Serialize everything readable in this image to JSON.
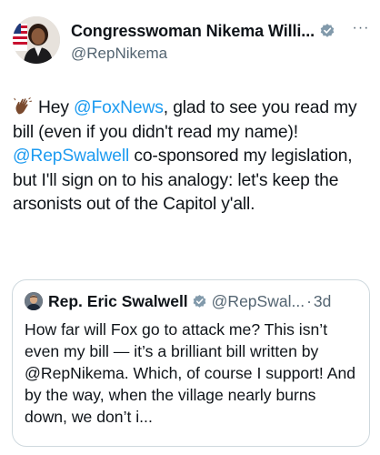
{
  "tweet": {
    "author": {
      "display_name": "Congresswoman Nikema Willi...",
      "handle": "@RepNikema",
      "verified_icon": "verified-badge-icon",
      "avatar_icon": "avatar"
    },
    "more_label": "···",
    "body": {
      "emoji_icon": "waving-hand-icon",
      "segments": [
        {
          "type": "text",
          "text": "Hey "
        },
        {
          "type": "mention",
          "text": "@FoxNews"
        },
        {
          "type": "text",
          "text": ", glad to see you read my bill (even if you didn't read my name)! "
        },
        {
          "type": "mention",
          "text": "@RepSwalwell"
        },
        {
          "type": "text",
          "text": " co-sponsored my legislation, but I'll sign on to his analogy: let's keep the arsonists out of the Capitol y'all."
        }
      ]
    },
    "quoted": {
      "display_name": "Rep. Eric Swalwell",
      "handle": "@RepSwal...",
      "separator": "·",
      "time": "3d",
      "text": "How far will Fox go to attack me? This isn’t even my bill — it’s a brilliant bill written by @RepNikema. Which, of course I support! And by the way, when the village nearly burns down, we don’t i..."
    }
  },
  "colors": {
    "text": "#0f1419",
    "secondary": "#536471",
    "link": "#1d9bf0",
    "border": "#cfd9de",
    "verified": "#829aab"
  }
}
